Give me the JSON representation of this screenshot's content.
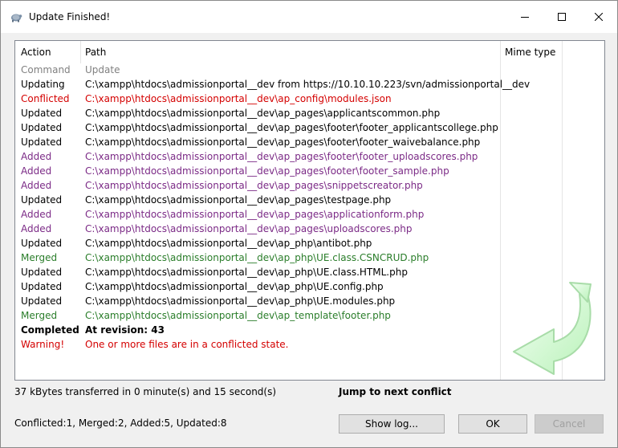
{
  "window": {
    "title": "Update Finished!"
  },
  "columns": {
    "action": "Action",
    "path": "Path",
    "mime": "Mime type"
  },
  "colors": {
    "command": "#808080",
    "normal": "#000000",
    "conflicted": "#d40000",
    "added": "#7b2a86",
    "merged": "#2a7d2a",
    "warning": "#d40000"
  },
  "rows": [
    {
      "action": "Command",
      "path": "Update",
      "kind": "command"
    },
    {
      "action": "Updating",
      "path": "C:\\xampp\\htdocs\\admissionportal__dev from https://10.10.10.223/svn/admissionportal__dev",
      "kind": "normal"
    },
    {
      "action": "Conflicted",
      "path": "C:\\xampp\\htdocs\\admissionportal__dev\\ap_config\\modules.json",
      "kind": "conflicted"
    },
    {
      "action": "Updated",
      "path": "C:\\xampp\\htdocs\\admissionportal__dev\\ap_pages\\applicantscommon.php",
      "kind": "normal"
    },
    {
      "action": "Updated",
      "path": "C:\\xampp\\htdocs\\admissionportal__dev\\ap_pages\\footer\\footer_applicantscollege.php",
      "kind": "normal"
    },
    {
      "action": "Updated",
      "path": "C:\\xampp\\htdocs\\admissionportal__dev\\ap_pages\\footer\\footer_waivebalance.php",
      "kind": "normal"
    },
    {
      "action": "Added",
      "path": "C:\\xampp\\htdocs\\admissionportal__dev\\ap_pages\\footer\\footer_uploadscores.php",
      "kind": "added"
    },
    {
      "action": "Added",
      "path": "C:\\xampp\\htdocs\\admissionportal__dev\\ap_pages\\footer\\footer_sample.php",
      "kind": "added"
    },
    {
      "action": "Added",
      "path": "C:\\xampp\\htdocs\\admissionportal__dev\\ap_pages\\snippetscreator.php",
      "kind": "added"
    },
    {
      "action": "Updated",
      "path": "C:\\xampp\\htdocs\\admissionportal__dev\\ap_pages\\testpage.php",
      "kind": "normal"
    },
    {
      "action": "Added",
      "path": "C:\\xampp\\htdocs\\admissionportal__dev\\ap_pages\\applicationform.php",
      "kind": "added"
    },
    {
      "action": "Added",
      "path": "C:\\xampp\\htdocs\\admissionportal__dev\\ap_pages\\uploadscores.php",
      "kind": "added"
    },
    {
      "action": "Updated",
      "path": "C:\\xampp\\htdocs\\admissionportal__dev\\ap_php\\antibot.php",
      "kind": "normal"
    },
    {
      "action": "Merged",
      "path": "C:\\xampp\\htdocs\\admissionportal__dev\\ap_php\\UE.class.CSNCRUD.php",
      "kind": "merged"
    },
    {
      "action": "Updated",
      "path": "C:\\xampp\\htdocs\\admissionportal__dev\\ap_php\\UE.class.HTML.php",
      "kind": "normal"
    },
    {
      "action": "Updated",
      "path": "C:\\xampp\\htdocs\\admissionportal__dev\\ap_php\\UE.config.php",
      "kind": "normal"
    },
    {
      "action": "Updated",
      "path": "C:\\xampp\\htdocs\\admissionportal__dev\\ap_php\\UE.modules.php",
      "kind": "normal"
    },
    {
      "action": "Merged",
      "path": "C:\\xampp\\htdocs\\admissionportal__dev\\ap_template\\footer.php",
      "kind": "merged"
    },
    {
      "action": "Completed",
      "path": "At revision: 43",
      "kind": "completed"
    },
    {
      "action": "Warning!",
      "path": "One or more files are in a conflicted state.",
      "kind": "warning"
    }
  ],
  "status": {
    "transferred": "37 kBytes transferred in 0 minute(s) and 15 second(s)",
    "jump_link": "Jump to next conflict",
    "counts": "Conflicted:1, Merged:2, Added:5, Updated:8"
  },
  "buttons": {
    "show_log": "Show log...",
    "ok": "OK",
    "cancel": "Cancel"
  }
}
